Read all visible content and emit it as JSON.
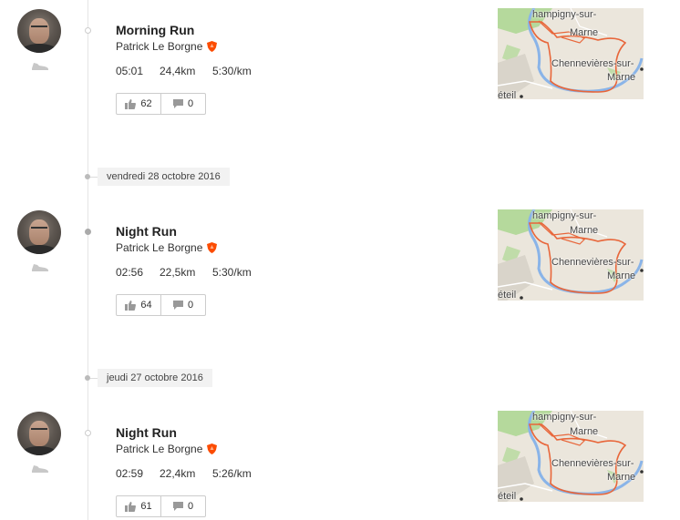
{
  "feed": {
    "entries": [
      {
        "title": "Morning Run",
        "athlete": "Patrick Le Borgne",
        "time": "05:01",
        "distance": "24,4km",
        "pace": "5:30/km",
        "kudos": "62",
        "comments": "0",
        "map_labels": [
          "hampigny-sur-",
          "Marne",
          "Chennevières-sur-",
          "Marne",
          "éteil"
        ]
      },
      {
        "title": "Night Run",
        "athlete": "Patrick Le Borgne",
        "time": "02:56",
        "distance": "22,5km",
        "pace": "5:30/km",
        "kudos": "64",
        "comments": "0",
        "map_labels": [
          "hampigny-sur-",
          "Marne",
          "Chennevières-sur-",
          "Marne",
          "éteil"
        ]
      },
      {
        "title": "Night Run",
        "athlete": "Patrick Le Borgne",
        "time": "02:59",
        "distance": "22,4km",
        "pace": "5:26/km",
        "kudos": "61",
        "comments": "0",
        "map_labels": [
          "hampigny-sur-",
          "Marne",
          "Chennevières-sur-",
          "Marne",
          "éteil"
        ]
      }
    ],
    "date_separators": [
      "vendredi 28 octobre 2016",
      "jeudi 27 octobre 2016"
    ]
  },
  "colors": {
    "brand_orange": "#fc4c02",
    "route": "#e8663a",
    "river": "#8ab4e8",
    "park": "#b5d99c"
  },
  "icons": {
    "sport": "shoe-icon",
    "athlete_badge": "premium-shield-icon",
    "kudos": "thumbs-up-icon",
    "comments": "comment-bubble-icon"
  }
}
